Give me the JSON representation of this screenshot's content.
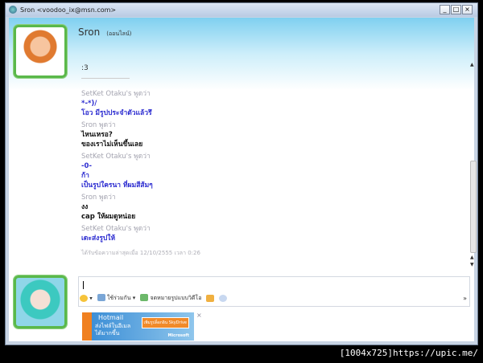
{
  "window": {
    "title": "Sron <voodoo_ix@msn.com>",
    "controls": [
      "_",
      "□",
      "×"
    ]
  },
  "contact": {
    "name": "Sron",
    "status": "(ออนไลน์)",
    "personal_message": ":3"
  },
  "messages": [
    {
      "sender": "SetKet Otaku's พูดว่า",
      "self": true,
      "lines": [
        "*-*)/",
        "โอว มีรูปประจำตัวแล้วรึ"
      ]
    },
    {
      "sender": "Sron พูดว่า",
      "self": false,
      "lines": [
        "ไหนเหรอ?",
        "ของเราไม่เห็นขึ้นเลย"
      ]
    },
    {
      "sender": "SetKet Otaku's พูดว่า",
      "self": true,
      "lines": [
        "-0-",
        "ก้า",
        "เป็นรูปใครนา ที่ผมสีส้มๆ"
      ]
    },
    {
      "sender": "Sron พูดว่า",
      "self": false,
      "lines": [
        "งง",
        "cap ให้ผมดูหน่อย"
      ]
    },
    {
      "sender": "SetKet Otaku's พูดว่า",
      "self": true,
      "lines": [
        "เดะส่งรูปให้"
      ]
    }
  ],
  "last_received": "ได้รับข้อความล่าสุดเมื่อ 12/10/2555 เวลา 0:26",
  "toolbar": {
    "share": "ใช้ร่วมกัน",
    "video_msg": "จดหมายรูปแบบวิดีโอ",
    "more": "»"
  },
  "ad": {
    "brand": "Hotmail",
    "text": [
      "ส่งไฟล์ในอีเมล",
      "ได้มากขึ้น"
    ],
    "button": "เพิ่มรูปล็อกอิน SkyDrive",
    "maker": "Microsoft",
    "close": "×"
  },
  "caption": "[1004x725]https://upic.me/"
}
